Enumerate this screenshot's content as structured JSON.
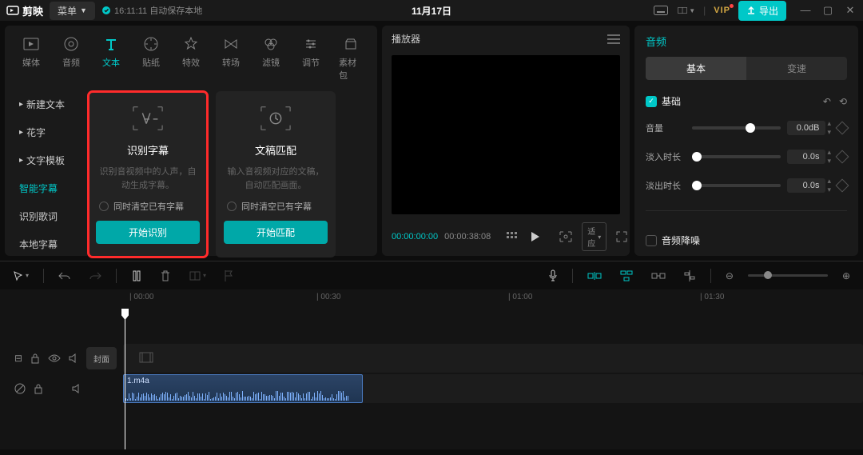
{
  "titlebar": {
    "app_name": "剪映",
    "menu_label": "菜单",
    "autosave_text": "16:11:11 自动保存本地",
    "project_title": "11月17日",
    "vip_label": "VIP",
    "export_label": "导出"
  },
  "top_tabs": [
    {
      "label": "媒体"
    },
    {
      "label": "音频"
    },
    {
      "label": "文本"
    },
    {
      "label": "贴纸"
    },
    {
      "label": "特效"
    },
    {
      "label": "转场"
    },
    {
      "label": "滤镜"
    },
    {
      "label": "调节"
    },
    {
      "label": "素材包"
    }
  ],
  "active_top_tab": 2,
  "side_items": [
    {
      "label": "新建文本",
      "chev": true
    },
    {
      "label": "花字",
      "chev": true
    },
    {
      "label": "文字模板",
      "chev": true
    },
    {
      "label": "智能字幕",
      "chev": false,
      "active": true
    },
    {
      "label": "识别歌词",
      "chev": false
    },
    {
      "label": "本地字幕",
      "chev": false
    }
  ],
  "cards": {
    "subtitle": {
      "title": "识别字幕",
      "desc": "识别音视频中的人声，自动生成字幕。",
      "check_label": "同时清空已有字幕",
      "btn": "开始识别"
    },
    "script": {
      "title": "文稿匹配",
      "desc": "输入音视频对应的文稿，自动匹配画面。",
      "check_label": "同时清空已有字幕",
      "btn": "开始匹配"
    }
  },
  "player": {
    "title": "播放器",
    "tc_current": "00:00:00:00",
    "tc_duration": "00:00:38:08",
    "fit_label": "适应"
  },
  "right_panel": {
    "title": "音频",
    "tabs": [
      "基本",
      "变速"
    ],
    "active_tab": 0,
    "section_title": "基础",
    "rows": {
      "volume": {
        "label": "音量",
        "value": "0.0dB",
        "thumb_pct": 60
      },
      "fadein": {
        "label": "淡入时长",
        "value": "0.0s",
        "thumb_pct": 0
      },
      "fadeout": {
        "label": "淡出时长",
        "value": "0.0s",
        "thumb_pct": 0
      }
    },
    "denoise_label": "音频降噪"
  },
  "timeline": {
    "ruler": [
      "00:00",
      "00:30",
      "01:00",
      "01:30"
    ],
    "cover_label": "封面",
    "clip_name": "1.m4a"
  }
}
